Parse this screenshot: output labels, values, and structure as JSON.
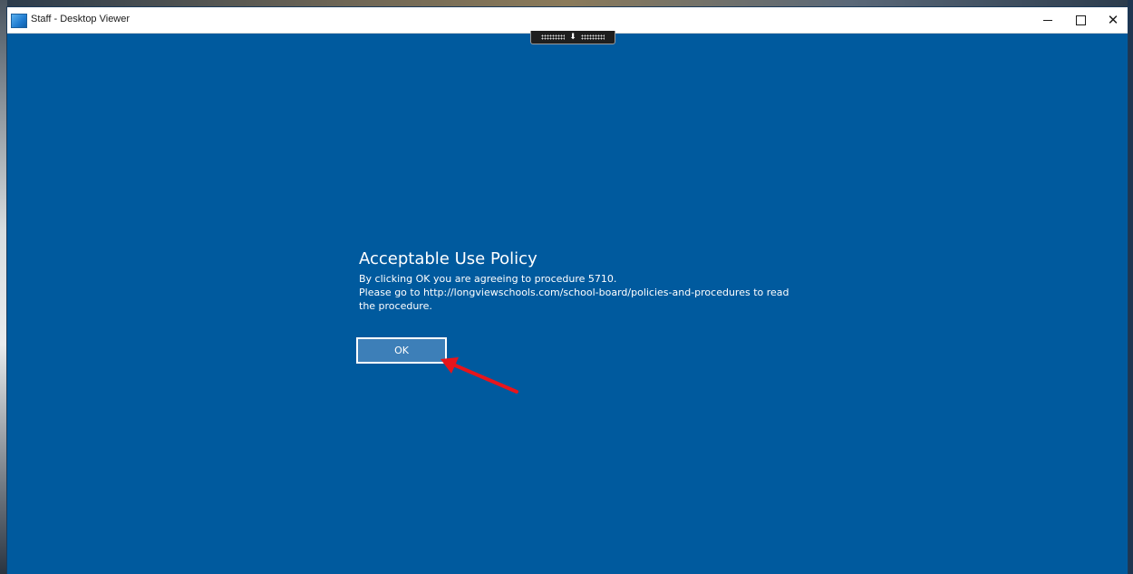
{
  "window": {
    "title": "Staff - Desktop Viewer",
    "icon": "desktop-viewer-app-icon",
    "controls": {
      "minimize_icon": "minimize-icon",
      "maximize_icon": "maximize-icon",
      "close_icon": "close-icon",
      "close_glyph": "✕"
    }
  },
  "connection_bar": {
    "arrow_glyph": "⬇",
    "icon": "grip-handle-icon"
  },
  "policy": {
    "title": "Acceptable Use Policy",
    "line1": "By clicking OK you are agreeing to procedure 5710.",
    "line2": "Please go to http://longviewschools.com/school-board/policies-and-procedures to read",
    "line3": "the procedure.",
    "ok_label": "OK"
  },
  "colors": {
    "background": "#005a9e",
    "button": "#3d7fb8",
    "annotation": "#e8151b"
  }
}
